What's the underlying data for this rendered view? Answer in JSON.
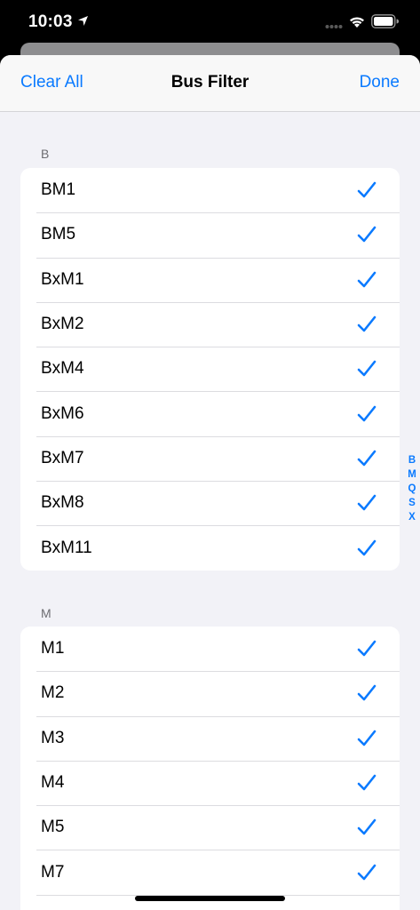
{
  "status_bar": {
    "time": "10:03"
  },
  "nav": {
    "left_label": "Clear All",
    "title": "Bus Filter",
    "right_label": "Done"
  },
  "sections": [
    {
      "header": "B",
      "items": [
        "BM1",
        "BM5",
        "BxM1",
        "BxM2",
        "BxM4",
        "BxM6",
        "BxM7",
        "BxM8",
        "BxM11"
      ]
    },
    {
      "header": "M",
      "items": [
        "M1",
        "M2",
        "M3",
        "M4",
        "M5",
        "M7"
      ]
    }
  ],
  "index_letters": [
    "B",
    "M",
    "Q",
    "S",
    "X"
  ],
  "colors": {
    "accent": "#0a7aff",
    "background": "#f2f2f7"
  },
  "icons": {
    "row_selected": "checkmark-icon"
  }
}
